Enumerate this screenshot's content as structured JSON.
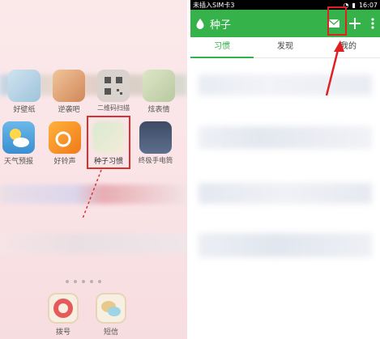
{
  "home_screen": {
    "apps_row1": [
      {
        "label": "好壁纸",
        "icon": "wallpaper-icon"
      },
      {
        "label": "逆袭吧",
        "icon": "game-icon"
      },
      {
        "label": "二维码扫描",
        "icon": "qrcode-icon"
      },
      {
        "label": "炫表情",
        "icon": "emoji-icon"
      }
    ],
    "apps_row2": [
      {
        "label": "天气预报",
        "icon": "weather-icon"
      },
      {
        "label": "好铃声",
        "icon": "ringtone-icon"
      },
      {
        "label": "种子习惯",
        "icon": "seed-habit-icon"
      },
      {
        "label": "终极手电筒",
        "icon": "flashlight-icon"
      }
    ],
    "dock": [
      {
        "label": "拨号",
        "icon": "dialer-icon"
      },
      {
        "label": "短信",
        "icon": "sms-icon"
      }
    ]
  },
  "app": {
    "status_bar": {
      "carrier": "未插入SIM卡3",
      "time": "16:07"
    },
    "title": "种子",
    "tabs": [
      {
        "label": "习惯",
        "active": true
      },
      {
        "label": "发现",
        "active": false
      },
      {
        "label": "我的",
        "active": false
      }
    ],
    "actions": [
      "mail-icon",
      "plus-icon",
      "more-icon"
    ]
  },
  "colors": {
    "brand_green": "#35b24a",
    "highlight_red": "#e02020",
    "home_bg": "#fbe9ea"
  }
}
